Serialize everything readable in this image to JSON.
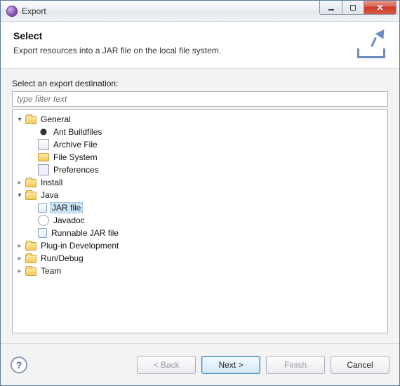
{
  "window": {
    "title": "Export"
  },
  "banner": {
    "heading": "Select",
    "description": "Export resources into a JAR file on the local file system."
  },
  "body": {
    "destination_label": "Select an export destination:",
    "filter_placeholder": "type filter text"
  },
  "tree": {
    "general": {
      "label": "General",
      "expanded": true,
      "children": {
        "ant": "Ant Buildfiles",
        "archive": "Archive File",
        "filesys": "File System",
        "prefs": "Preferences"
      }
    },
    "install": {
      "label": "Install",
      "expanded": false
    },
    "java": {
      "label": "Java",
      "expanded": true,
      "children": {
        "jar": "JAR file",
        "javadoc": "Javadoc",
        "runnable": "Runnable JAR file"
      }
    },
    "plugin": {
      "label": "Plug-in Development",
      "expanded": false
    },
    "rundebug": {
      "label": "Run/Debug",
      "expanded": false
    },
    "team": {
      "label": "Team",
      "expanded": false
    }
  },
  "selected": "tree.java.children.jar",
  "footer": {
    "back": "< Back",
    "next": "Next >",
    "finish": "Finish",
    "cancel": "Cancel"
  }
}
